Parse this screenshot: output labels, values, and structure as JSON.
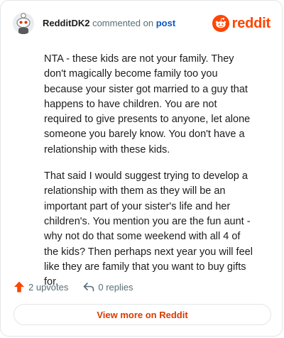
{
  "header": {
    "username": "RedditDK2",
    "commented_on": "commented on",
    "post_link": "post",
    "logo_text": "reddit",
    "brand_color": "#ff4500"
  },
  "comment": {
    "paragraphs": [
      "NTA - these kids are not your family. They don't magically become family too you because your sister got married to a guy that happens to have children. You are not required to give presents to anyone, let alone someone you barely know. You don't have a relationship with these kids.",
      "That said I would suggest trying to develop a relationship with them as they will be an important part of your sister's life and her children's. You mention you are the fun aunt - why not do that some weekend with all 4 of the kids? Then perhaps next year you will feel like they are family that you want to buy gifts for."
    ]
  },
  "actions": {
    "upvotes": "2 upvotes",
    "replies": "0 replies"
  },
  "footer": {
    "view_more": "View more on Reddit"
  }
}
